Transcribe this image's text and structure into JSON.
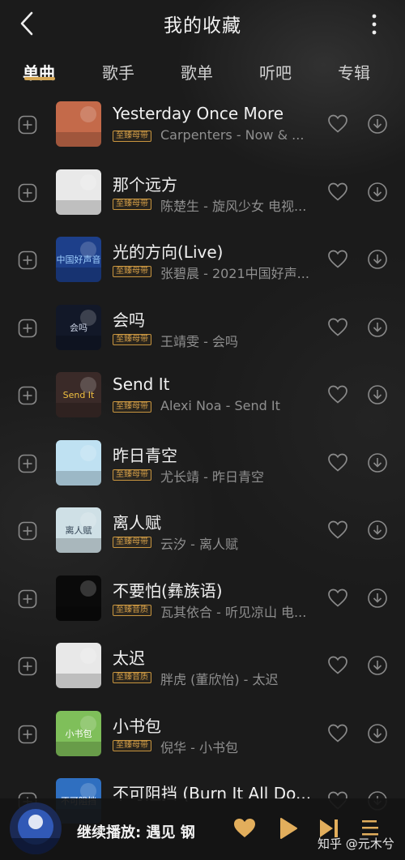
{
  "header": {
    "title": "我的收藏"
  },
  "tabs": [
    {
      "label": "单曲",
      "active": true
    },
    {
      "label": "歌手",
      "active": false
    },
    {
      "label": "歌单",
      "active": false
    },
    {
      "label": "听吧",
      "active": false
    },
    {
      "label": "专辑",
      "active": false
    }
  ],
  "songs": [
    {
      "title": "Yesterday Once More",
      "badge": "至臻母带",
      "subtitle": "Carpenters - Now & ..."
    },
    {
      "title": "那个远方",
      "badge": "至臻母带",
      "subtitle": "陈楚生 - 旋风少女 电视..."
    },
    {
      "title": "光的方向(Live)",
      "badge": "至臻母带",
      "subtitle": "张碧晨 - 2021中国好声..."
    },
    {
      "title": "会吗",
      "badge": "至臻母带",
      "subtitle": "王靖雯 - 会吗"
    },
    {
      "title": "Send It",
      "badge": "至臻母带",
      "subtitle": "Alexi Noa - Send It"
    },
    {
      "title": "昨日青空",
      "badge": "至臻母带",
      "subtitle": "尤长靖 - 昨日青空"
    },
    {
      "title": "离人赋",
      "badge": "至臻母带",
      "subtitle": "云汐 - 离人赋"
    },
    {
      "title": "不要怕(彝族语)",
      "badge": "至臻音质",
      "subtitle": "瓦其依合 - 听见凉山 电..."
    },
    {
      "title": "太迟",
      "badge": "至臻音质",
      "subtitle": "胖虎 (董欣怡) - 太迟"
    },
    {
      "title": "小书包",
      "badge": "至臻母带",
      "subtitle": "倪华 - 小书包"
    },
    {
      "title": "不可阻挡 (Burn It All Do...",
      "badge": "",
      "subtitle": ""
    }
  ],
  "cover_art": [
    {
      "text": "",
      "bg": "#c46a4a",
      "fg": "#ffffff"
    },
    {
      "text": "",
      "bg": "#e9e9e9",
      "fg": "#333333"
    },
    {
      "text": "中国好声音",
      "bg": "#1d3f8a",
      "fg": "#9fd0ff"
    },
    {
      "text": "会吗",
      "bg": "#121828",
      "fg": "#cfd7e8"
    },
    {
      "text": "Send It",
      "bg": "#3a2a28",
      "fg": "#f0c040"
    },
    {
      "text": "",
      "bg": "#bfe1f2",
      "fg": "#2a5f80"
    },
    {
      "text": "离人赋",
      "bg": "#cfe0e6",
      "fg": "#334455"
    },
    {
      "text": "",
      "bg": "#0a0a0a",
      "fg": "#d8a840"
    },
    {
      "text": "",
      "bg": "#e8e8e8",
      "fg": "#555555"
    },
    {
      "text": "小书包",
      "bg": "#7fbf5a",
      "fg": "#ffffff"
    },
    {
      "text": "不可阻挡",
      "bg": "#2f6fc0",
      "fg": "#ffffff"
    }
  ],
  "player": {
    "prefix": "继续播放:",
    "title": "遇见 钢",
    "cover_bg": "#3a6ee0"
  },
  "watermark": "知乎 @元木兮",
  "colors": {
    "accent": "#d7a855",
    "badge": "#c8953f",
    "background": "#1b1b1b"
  },
  "icons": {
    "back": "chevron-left-icon",
    "more": "vertical-dots-icon",
    "add": "plus-square-icon",
    "heart": "heart-outline-icon",
    "download": "download-circle-icon",
    "player_heart": "heart-filled-icon",
    "play": "play-icon",
    "next": "skip-next-icon",
    "playlist": "playlist-icon"
  }
}
